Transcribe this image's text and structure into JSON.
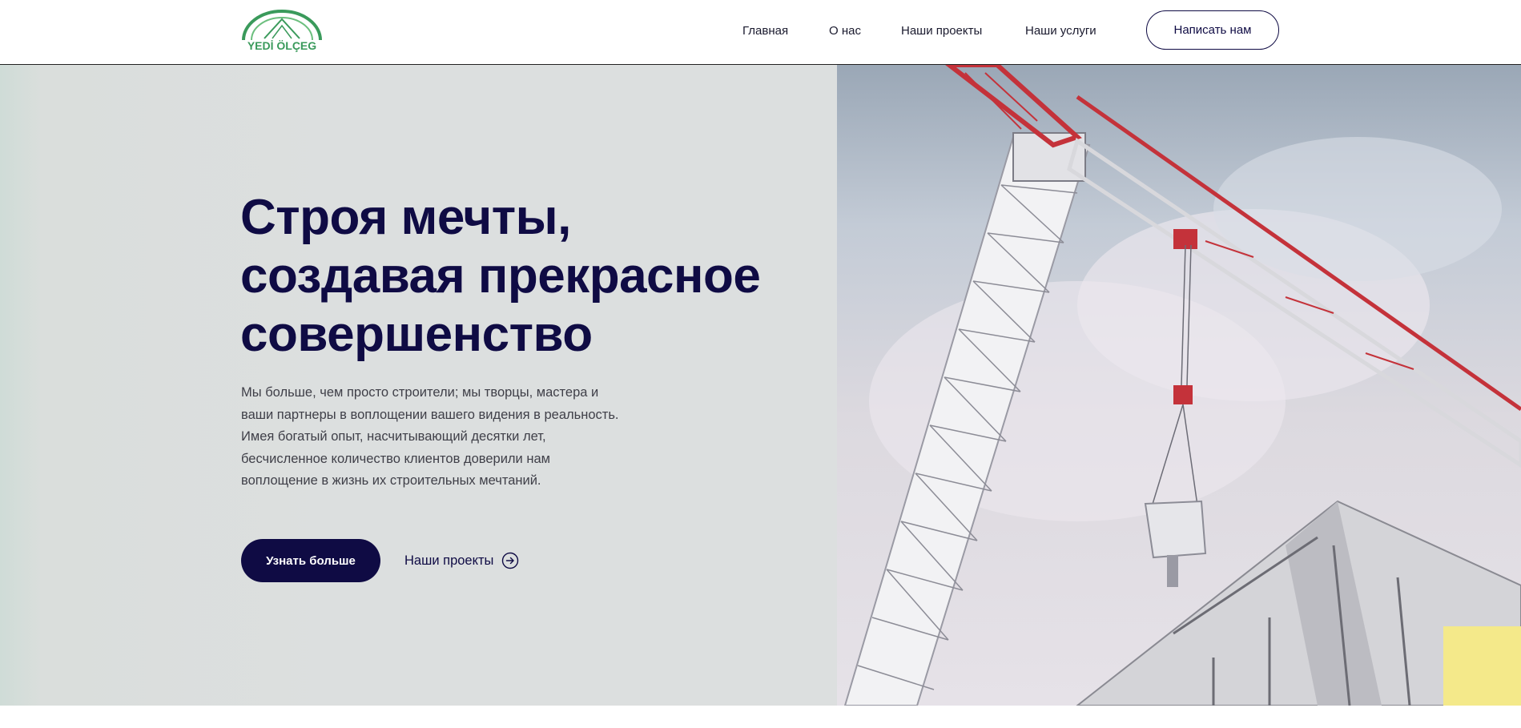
{
  "header": {
    "logo_text": "YEDİ ÖLÇEG",
    "nav": [
      {
        "label": "Главная"
      },
      {
        "label": "О нас"
      },
      {
        "label": "Наши проекты"
      },
      {
        "label": "Наши услуги"
      }
    ],
    "contact_label": "Написать нам"
  },
  "hero": {
    "title_lines": [
      "Строя мечты,",
      "создавая прекрасное",
      "совершенство"
    ],
    "description_lines": [
      "Мы больше, чем просто строители; мы творцы, мастера и",
      "ваши партнеры в воплощении вашего видения в реальность.",
      "Имея богатый опыт, насчитывающий десятки лет,",
      "бесчисленное количество клиентов доверили нам",
      "воплощение в жизнь их строительных мечтаний."
    ],
    "primary_button": "Узнать больше",
    "secondary_link": "Наши проекты",
    "secondary_icon": "arrow-right-circle-icon",
    "image": "construction-crane-photo"
  },
  "colors": {
    "brand_navy": "#0f0b44",
    "logo_green": "#3a9a5b",
    "accent_yellow": "#f4e98a",
    "crane_red": "#c4323a"
  }
}
